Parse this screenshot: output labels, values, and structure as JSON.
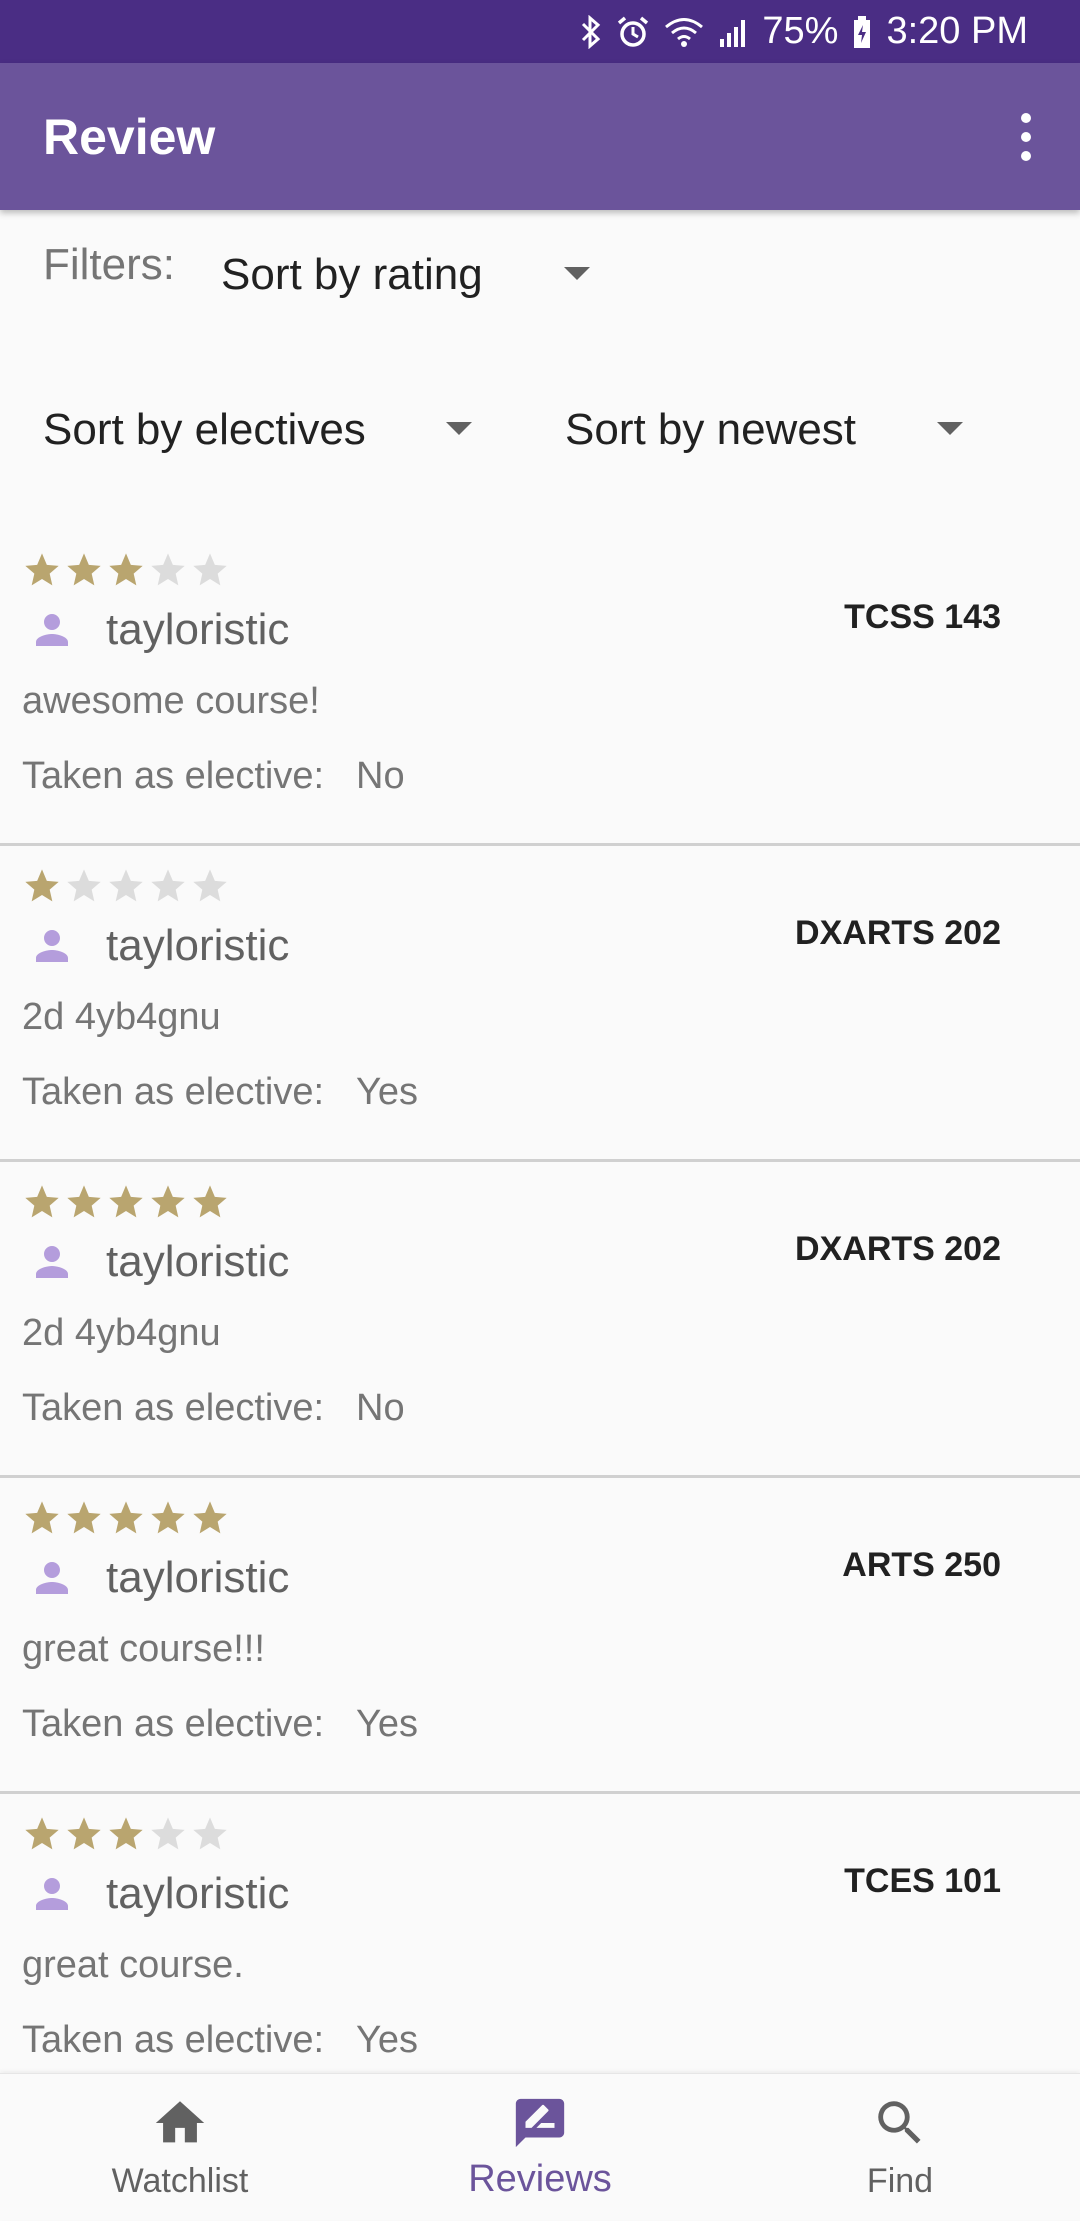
{
  "status_bar": {
    "battery": "75%",
    "time": "3:20 PM",
    "icons": [
      "bluetooth-icon",
      "alarm-icon",
      "wifi-icon",
      "signal-icon",
      "battery-icon"
    ]
  },
  "app_bar": {
    "title": "Review",
    "menu_icon": "overflow-menu-icon"
  },
  "filters": {
    "label": "Filters:",
    "rating": "Sort by rating",
    "electives": "Sort by electives",
    "newest": "Sort by newest"
  },
  "colors": {
    "status_bar": "#4a2d84",
    "app_bar": "#6b549b",
    "star_filled": "#b9a56f",
    "star_empty": "#dcdcdc",
    "avatar": "#b49ddc",
    "active_nav": "#6b549b"
  },
  "reviews": [
    {
      "rating": 3,
      "max_rating": 5,
      "course": "TCSS 143",
      "user": "tayloristic",
      "text": "awesome course!",
      "elective_label": "Taken as elective:",
      "elective": "No"
    },
    {
      "rating": 1,
      "max_rating": 5,
      "course": "DXARTS 202",
      "user": "tayloristic",
      "text": "2d 4yb4gnu",
      "elective_label": "Taken as elective:",
      "elective": "Yes"
    },
    {
      "rating": 5,
      "max_rating": 5,
      "course": "DXARTS 202",
      "user": "tayloristic",
      "text": "2d 4yb4gnu",
      "elective_label": "Taken as elective:",
      "elective": "No"
    },
    {
      "rating": 5,
      "max_rating": 5,
      "course": "ARTS 250",
      "user": "tayloristic",
      "text": "great course!!!",
      "elective_label": "Taken as elective:",
      "elective": "Yes"
    },
    {
      "rating": 3,
      "max_rating": 5,
      "course": "TCES 101",
      "user": "tayloristic",
      "text": "great course.",
      "elective_label": "Taken as elective:",
      "elective": "Yes"
    }
  ],
  "bottom_nav": {
    "items": [
      {
        "label": "Watchlist",
        "icon": "home-icon",
        "active": false
      },
      {
        "label": "Reviews",
        "icon": "rate-review-icon",
        "active": true
      },
      {
        "label": "Find",
        "icon": "search-icon",
        "active": false
      }
    ]
  }
}
